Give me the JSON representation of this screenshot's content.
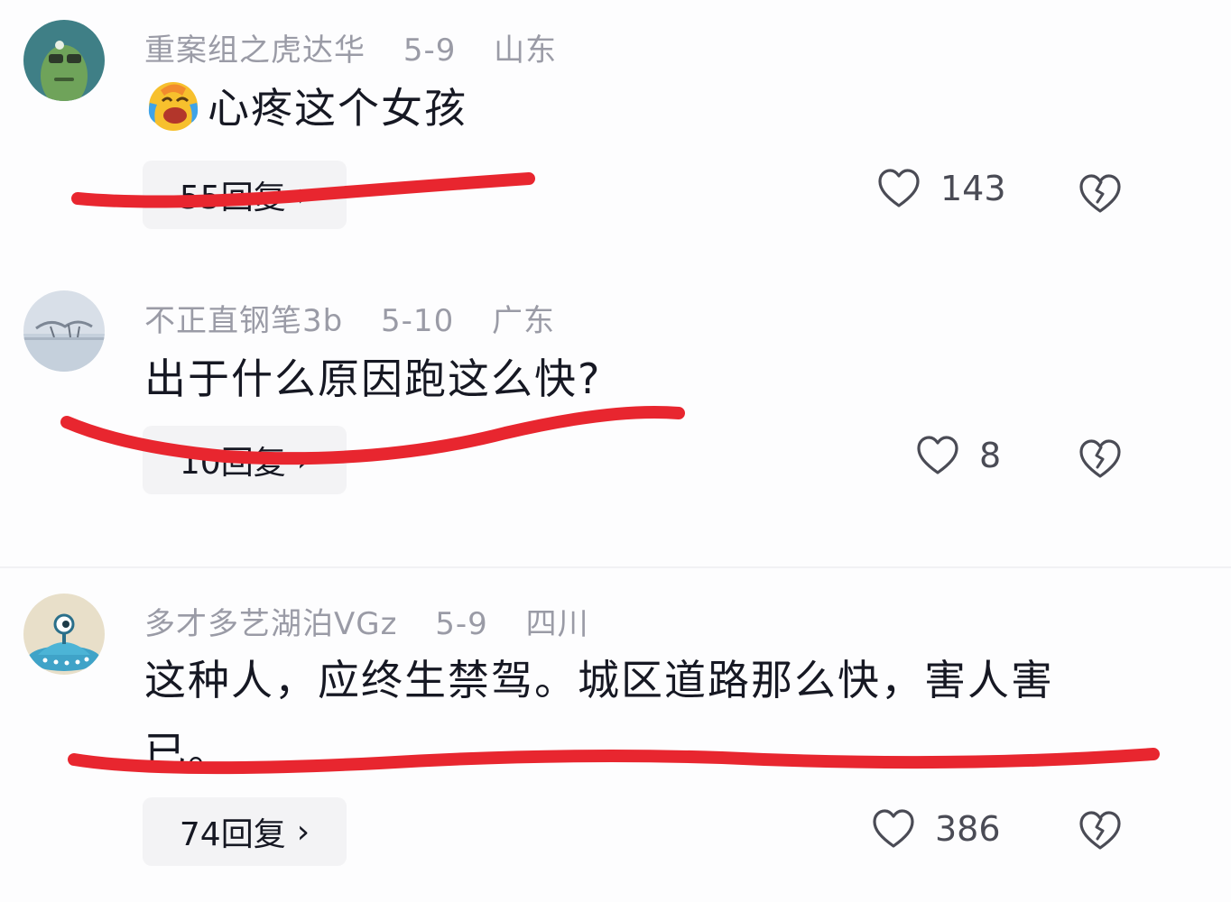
{
  "comments": [
    {
      "username": "重案组之虎达华",
      "date": "5-9",
      "location": "山东",
      "text": "心疼这个女孩",
      "emoji": "face-with-tears-of-joy-emoji",
      "reply_label": "55回复",
      "like_count": "143"
    },
    {
      "username": "不正直钢笔3b",
      "date": "5-10",
      "location": "广东",
      "text": "出于什么原因跑这么快?",
      "reply_label": "10回复",
      "like_count": "8"
    },
    {
      "username": "多才多艺湖泊VGz",
      "date": "5-9",
      "location": "四川",
      "text_line1": "这种人，应终生禁驾。城区道路那么快，害人害",
      "text_line2": "已。",
      "reply_label": "74回复",
      "like_count": "386"
    }
  ],
  "icons": {
    "like": "heart-outline-icon",
    "dislike": "broken-heart-icon",
    "reply_chevron": "chevron-right-icon"
  },
  "colors": {
    "annotation_strike": "#e8262f",
    "meta_text": "#9a9ba6",
    "body_text": "#161823",
    "reply_bg": "#f3f3f5"
  }
}
